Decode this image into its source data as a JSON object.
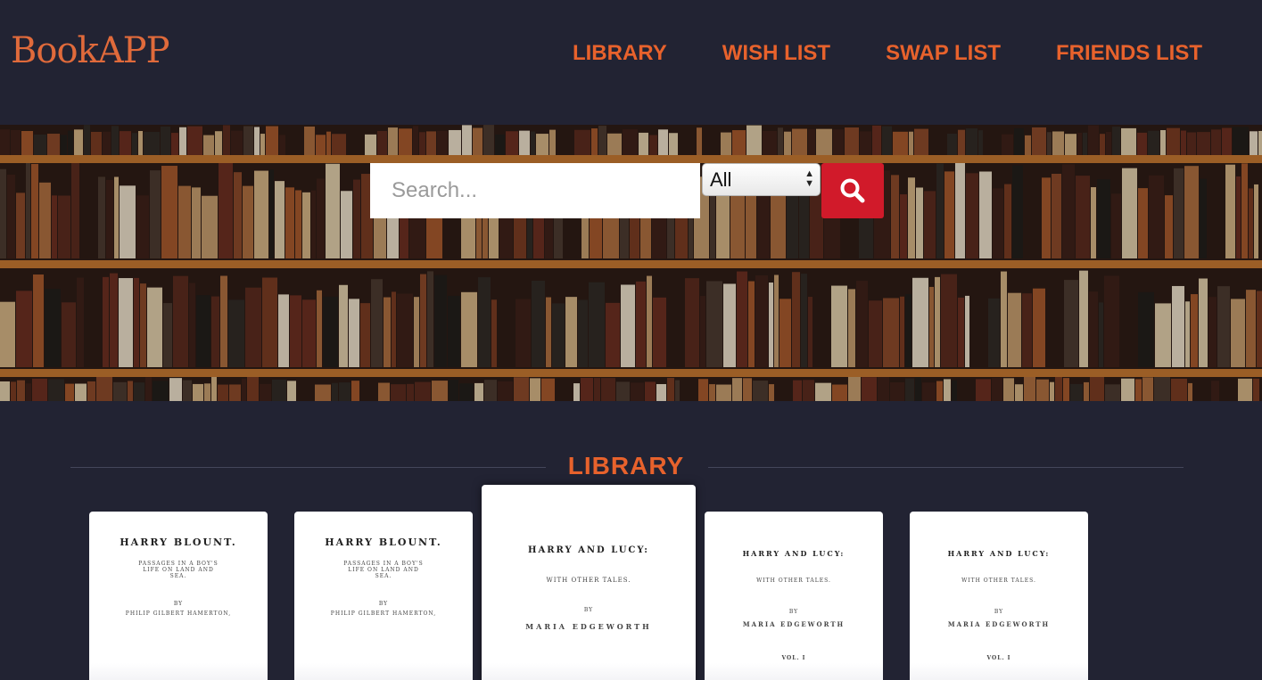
{
  "app": {
    "logo": "BookAPP"
  },
  "nav": {
    "items": [
      {
        "label": "LIBRARY"
      },
      {
        "label": "WISH LIST"
      },
      {
        "label": "SWAP LIST"
      },
      {
        "label": "FRIENDS LIST"
      }
    ]
  },
  "search": {
    "placeholder": "Search...",
    "filter_value": "All",
    "button_icon": "search-icon"
  },
  "library": {
    "heading": "LIBRARY",
    "books": [
      {
        "title": "HARRY BLOUNT.",
        "subtitle": "PASSAGES IN A BOY'S LIFE ON LAND AND SEA.",
        "by": "BY",
        "author": "PHILIP GILBERT HAMERTON,"
      },
      {
        "title": "HARRY BLOUNT.",
        "subtitle": "PASSAGES IN A BOY'S LIFE ON LAND AND SEA.",
        "by": "BY",
        "author": "PHILIP GILBERT HAMERTON,"
      },
      {
        "title": "HARRY AND LUCY:",
        "subtitle": "WITH OTHER TALES.",
        "by": "BY",
        "author": "MARIA EDGEWORTH"
      },
      {
        "title": "HARRY AND LUCY:",
        "subtitle": "WITH OTHER TALES.",
        "by": "BY",
        "author": "MARIA EDGEWORTH",
        "volume": "VOL. I"
      },
      {
        "title": "HARRY AND LUCY:",
        "subtitle": "WITH OTHER TALES.",
        "by": "BY",
        "author": "MARIA EDGEWORTH",
        "volume": "VOL. I"
      }
    ]
  },
  "colors": {
    "background": "#222333",
    "accent": "#e8622c",
    "search_button": "#d11a2a"
  }
}
